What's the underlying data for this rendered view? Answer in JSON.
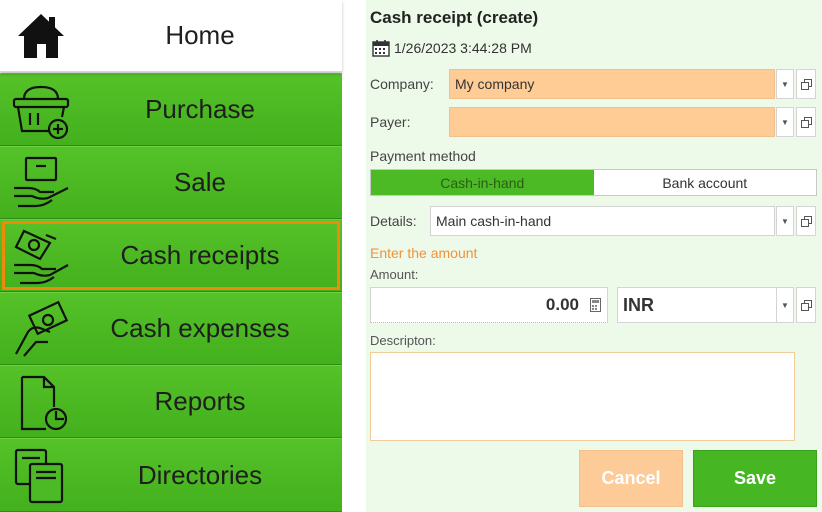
{
  "nav": {
    "home": "Home",
    "purchase": "Purchase",
    "sale": "Sale",
    "cash_receipts": "Cash receipts",
    "cash_expenses": "Cash expenses",
    "reports": "Reports",
    "directories": "Directories"
  },
  "form": {
    "title": "Cash receipt (create)",
    "date": "1/26/2023 3:44:28 PM",
    "company_label": "Company:",
    "company_value": "My company",
    "payer_label": "Payer:",
    "payer_value": "",
    "payment_method_label": "Payment method",
    "payment_methods": [
      "Cash-in-hand",
      "Bank account"
    ],
    "selected_payment_method": "Cash-in-hand",
    "details_label": "Details:",
    "details_value": "Main cash-in-hand",
    "hint": "Enter the amount",
    "amount_label": "Amount:",
    "amount_value": "0.00",
    "currency_value": "INR",
    "description_label": "Descripton:",
    "description_value": "",
    "cancel_label": "Cancel",
    "save_label": "Save"
  },
  "icons": {
    "calendar": "calendar-icon",
    "dropdown": "chevron-down-icon",
    "open": "open-window-icon",
    "calculator": "calculator-icon"
  },
  "colors": {
    "nav_green": "#4cba25",
    "selected_outline": "#f08a0c",
    "form_bg": "#edf9e9",
    "required_field": "#ffcc96",
    "save": "#46b623",
    "cancel": "#fdcb98",
    "hint": "#f0933a"
  }
}
